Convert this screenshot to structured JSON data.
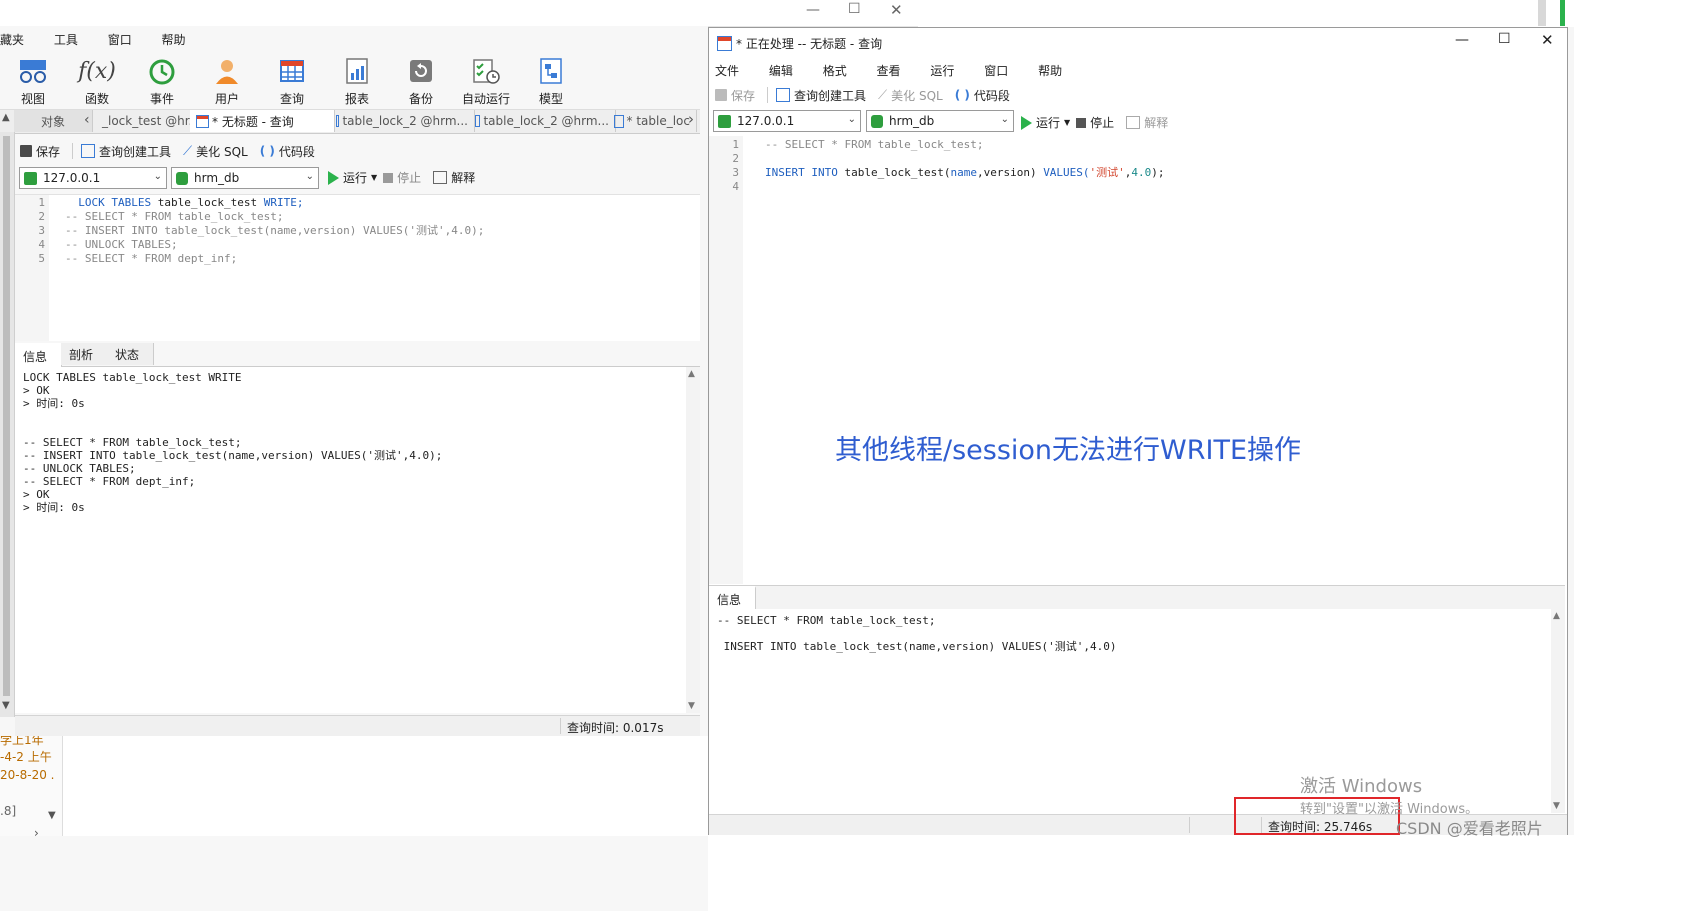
{
  "left_window": {
    "menu": [
      "藏夹",
      "工具",
      "窗口",
      "帮助"
    ],
    "big_toolbar": [
      {
        "label": "视图",
        "icon": "view-icon"
      },
      {
        "label": "函数",
        "icon": "function-icon"
      },
      {
        "label": "事件",
        "icon": "event-clock-icon"
      },
      {
        "label": "用户",
        "icon": "user-icon"
      },
      {
        "label": "查询",
        "icon": "query-grid-icon"
      },
      {
        "label": "报表",
        "icon": "report-icon"
      },
      {
        "label": "备份",
        "icon": "backup-icon"
      },
      {
        "label": "自动运行",
        "icon": "schedule-icon"
      },
      {
        "label": "模型",
        "icon": "model-icon"
      }
    ],
    "tabs": {
      "objects": "对象",
      "items": [
        "_lock_test @hr...",
        "* 无标题 - 查询",
        "table_lock_2 @hrm...",
        "table_lock_2 @hrm...",
        "* table_loc"
      ]
    },
    "editor_toolbar": {
      "save": "保存",
      "builder": "查询创建工具",
      "beautify": "美化 SQL",
      "snippet": "代码段"
    },
    "connection": "127.0.0.1",
    "database": "hrm_db",
    "run": "运行",
    "stop": "停止",
    "explain": "解释",
    "code_line_numbers": [
      "1",
      "2",
      "3",
      "4",
      "5"
    ],
    "code": {
      "l1_kw1": "LOCK TABLES ",
      "l1_id": "table_lock_test ",
      "l1_kw2": "WRITE;",
      "l2": "-- SELECT * FROM table_lock_test;",
      "l3": "-- INSERT INTO table_lock_test(name,version) VALUES('测试',4.0);",
      "l4": "-- UNLOCK TABLES;",
      "l5": "-- SELECT * FROM dept_inf;"
    },
    "result_tabs": [
      "信息",
      "剖析",
      "状态"
    ],
    "output_lines": [
      "LOCK TABLES table_lock_test WRITE",
      "> OK",
      "> 时间: 0s",
      "",
      "",
      "-- SELECT * FROM table_lock_test;",
      "-- INSERT INTO table_lock_test(name,version) VALUES('测试',4.0);",
      "-- UNLOCK TABLES;",
      "-- SELECT * FROM dept_inf;",
      "> OK",
      "> 时间: 0s"
    ],
    "status_query_time": "查询时间: 0.017s",
    "bottom_fragments": [
      "学上1年",
      "-4-2 上午",
      "20-8-20 .",
      ".8]"
    ]
  },
  "right_window": {
    "title": "* 正在处理 -- 无标题 - 查询",
    "menu": [
      "文件",
      "编辑",
      "格式",
      "查看",
      "运行",
      "窗口",
      "帮助"
    ],
    "editor_toolbar": {
      "save": "保存",
      "builder": "查询创建工具",
      "beautify": "美化 SQL",
      "snippet": "代码段"
    },
    "connection": "127.0.0.1",
    "database": "hrm_db",
    "run": "运行",
    "stop": "停止",
    "explain": "解释",
    "code_line_numbers": [
      "1",
      "2",
      "3",
      "4"
    ],
    "code": {
      "l1": "-- SELECT * FROM table_lock_test;",
      "l3_kw1": "INSERT INTO ",
      "l3_id": "table_lock_test(",
      "l3_f1": "name",
      "l3_comma": ",",
      "l3_f2": "version",
      "l3_close": ") ",
      "l3_kw2": "VALUES(",
      "l3_str": "'测试'",
      "l3_comma2": ",",
      "l3_num": "4.0",
      "l3_end": ");"
    },
    "annotation": "其他线程/session无法进行WRITE操作",
    "result_tab": "信息",
    "output_lines": [
      "-- SELECT * FROM table_lock_test;",
      "",
      " INSERT INTO table_lock_test(name,version) VALUES('测试',4.0)"
    ],
    "status_query_time": "查询时间: 25.746s"
  },
  "watermark": {
    "activate_title": "激活 Windows",
    "activate_sub": "转到\"设置\"以激活 Windows。",
    "csdn": "CSDN @爱看老照片"
  },
  "colors": {
    "annotation": "#2f5dd0",
    "highlight_box": "#e0262a",
    "run_green": "#2bb24c",
    "keyword_blue": "#1f5fbf",
    "string_red": "#d2452d"
  }
}
